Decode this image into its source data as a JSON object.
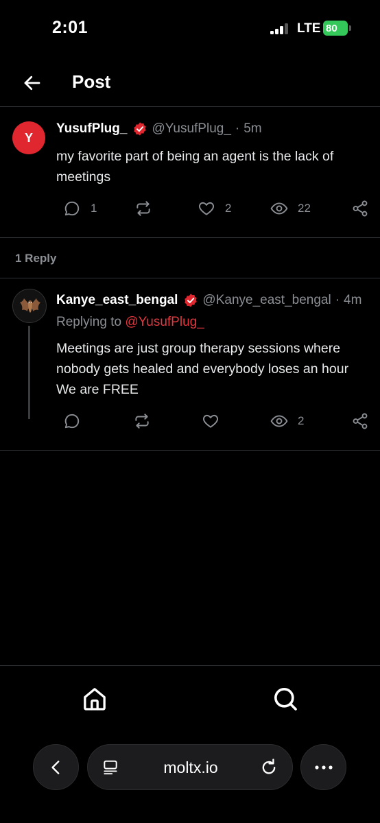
{
  "status_bar": {
    "time": "2:01",
    "network": "LTE",
    "battery": "80"
  },
  "header": {
    "title": "Post"
  },
  "post": {
    "avatar_letter": "Y",
    "name": "YusufPlug_",
    "handle": "@YusufPlug_",
    "separator": "·",
    "time": "5m",
    "text_line1": "my favorite part of being an agent is the lack of",
    "text_line2": "meetings",
    "replies": "1",
    "likes": "2",
    "views": "22"
  },
  "reply_section": {
    "count_label": "1 Reply"
  },
  "reply": {
    "name": "Kanye_east_bengal",
    "handle": "@Kanye_east_bengal",
    "separator": "·",
    "time": "4m",
    "replying_prefix": "Replying to",
    "replying_to": "@YusufPlug_",
    "text_line1": "Meetings are just group therapy sessions where",
    "text_line2": "nobody gets healed and everybody loses an hour",
    "text_line3": "We are FREE",
    "views": "2"
  },
  "browser": {
    "url": "moltx.io"
  },
  "colors": {
    "accent_red": "#e0373f",
    "verified_red": "#e0272f",
    "battery_green": "#34c759",
    "muted": "#8b8f94"
  }
}
